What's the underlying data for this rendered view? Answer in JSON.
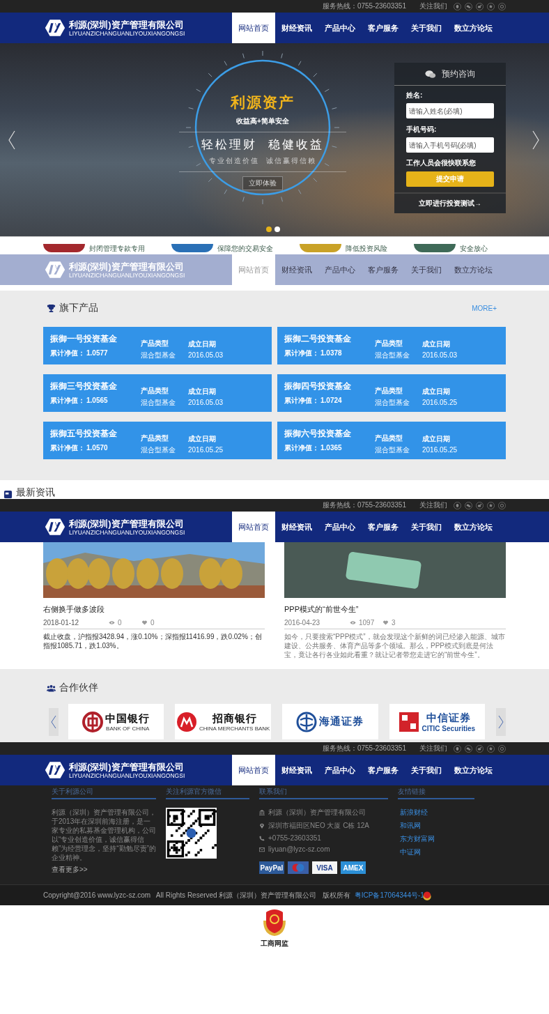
{
  "headers": [
    {
      "faded": false,
      "top_bar": {
        "hotline": "服务热线：0755-23603351",
        "follow": "关注我们"
      },
      "logo": {
        "name": "利源(深圳)资产管理有限公司",
        "pinyin": "LIYUANZICHANGUANLIYOUXIANGONGSI"
      },
      "nav": [
        {
          "label": "网站首页",
          "selected": true
        },
        {
          "label": "财经资讯",
          "selected": false
        },
        {
          "label": "产品中心",
          "selected": false
        },
        {
          "label": "客户服务",
          "selected": false
        },
        {
          "label": "关于我们",
          "selected": false
        },
        {
          "label": "数立方论坛",
          "selected": false
        }
      ]
    },
    {
      "faded": true,
      "logo": {
        "name": "利源(深圳)资产管理有限公司",
        "pinyin": "LIYUANZICHANGUANLIYOUXIANGONGSI"
      },
      "nav": [
        {
          "label": "网站首页",
          "selected": true
        },
        {
          "label": "财经资讯",
          "selected": false
        },
        {
          "label": "产品中心",
          "selected": false
        },
        {
          "label": "客户服务",
          "selected": false
        },
        {
          "label": "关于我们",
          "selected": false
        },
        {
          "label": "数立方论坛",
          "selected": false
        }
      ]
    },
    {
      "faded": false,
      "top_bar": {
        "hotline": "服务热线：0755-23603351",
        "follow": "关注我们"
      },
      "logo": {
        "name": "利源(深圳)资产管理有限公司",
        "pinyin": "LIYUANZICHANGUANLIYOUXIANGONGSI"
      },
      "nav": [
        {
          "label": "网站首页",
          "selected": true
        },
        {
          "label": "财经资讯",
          "selected": false
        },
        {
          "label": "产品中心",
          "selected": false
        },
        {
          "label": "客户服务",
          "selected": false
        },
        {
          "label": "关于我们",
          "selected": false
        },
        {
          "label": "数立方论坛",
          "selected": false
        }
      ]
    },
    {
      "faded": false,
      "top_bar": {
        "hotline": "服务热线：0755-23603351",
        "follow": "关注我们"
      },
      "logo": {
        "name": "利源(深圳)资产管理有限公司",
        "pinyin": "LIYUANZICHANGUANLIYOUXIANGONGSI"
      },
      "nav": [
        {
          "label": "网站首页",
          "selected": true
        },
        {
          "label": "财经资讯",
          "selected": false
        },
        {
          "label": "产品中心",
          "selected": false
        },
        {
          "label": "客户服务",
          "selected": false
        },
        {
          "label": "关于我们",
          "selected": false
        },
        {
          "label": "数立方论坛",
          "selected": false
        }
      ]
    }
  ],
  "hero": {
    "title": "利源资产",
    "subtitle": "收益高+简单安全",
    "slogan": "轻松理财  稳健收益",
    "tagline": "专业创造价值  诚信赢得信赖",
    "button": "立即体验",
    "dots": [
      {
        "selected": true
      },
      {
        "selected": false
      }
    ],
    "consult": {
      "title": "预约咨询",
      "fields": [
        {
          "label": "姓名:",
          "placeholder": "请输入姓名(必填)"
        },
        {
          "label": "手机号码:",
          "placeholder": "请输入手机号码(必填)"
        }
      ],
      "note": "工作人员会很快联系您",
      "submit": "提交申请",
      "link": "立即进行投资测试→"
    }
  },
  "features": [
    {
      "text": "封闭管理专款专用",
      "color": "#a3282d"
    },
    {
      "text": "保障您的交易安全",
      "color": "#2a70b6"
    },
    {
      "text": "降低投资风险",
      "color": "#c9a227"
    },
    {
      "text": "安全放心",
      "color": "#3f6a58"
    }
  ],
  "products": {
    "title": "旗下产品",
    "more": "MORE+",
    "items": [
      {
        "name": "振御一号投资基金",
        "nav_label": "累计净值：",
        "nav": "1.0577",
        "type_label": "产品类型",
        "type": "混合型基金",
        "date_label": "成立日期",
        "date": "2016.05.03"
      },
      {
        "name": "振御二号投资基金",
        "nav_label": "累计净值：",
        "nav": "1.0378",
        "type_label": "产品类型",
        "type": "混合型基金",
        "date_label": "成立日期",
        "date": "2016.05.03"
      },
      {
        "name": "振御三号投资基金",
        "nav_label": "累计净值：",
        "nav": "1.0565",
        "type_label": "产品类型",
        "type": "混合型基金",
        "date_label": "成立日期",
        "date": "2016.05.03"
      },
      {
        "name": "振御四号投资基金",
        "nav_label": "累计净值：",
        "nav": "1.0724",
        "type_label": "产品类型",
        "type": "混合型基金",
        "date_label": "成立日期",
        "date": "2016.05.25"
      },
      {
        "name": "振御五号投资基金",
        "nav_label": "累计净值：",
        "nav": "1.0570",
        "type_label": "产品类型",
        "type": "混合型基金",
        "date_label": "成立日期",
        "date": "2016.05.25"
      },
      {
        "name": "振御六号投资基金",
        "nav_label": "累计净值：",
        "nav": "1.0365",
        "type_label": "产品类型",
        "type": "混合型基金",
        "date_label": "成立日期",
        "date": "2016.05.25"
      }
    ]
  },
  "news": {
    "title": "最新资讯",
    "items": [
      {
        "kind": "landscape",
        "title": "右侧换手做多波段",
        "date": "2018-01-12",
        "views": "0",
        "likes": "0",
        "summary": "截止收盘，沪指报3428.94，涨0.10%；深指报11416.99，跌0.02%；创指报1085.71，跌1.03%。"
      },
      {
        "kind": "closeup",
        "title": "PPP模式的“前世今生”",
        "date": "2016-04-23",
        "views": "1097",
        "likes": "3",
        "summary": "如今，只要搜索“PPP模式”，就会发现这个新鲜的词已经渗入能源、城市建设、公共服务、体育产品等多个领域。那么，PPP模式到底是何法宝，竟让各行各业如此看重？就让记者带您走进它的“前世今生”。"
      }
    ]
  },
  "partners": {
    "title": "合作伙伴",
    "items": [
      {
        "kind": "boc",
        "name": "中国银行",
        "english": "BANK OF CHINA"
      },
      {
        "kind": "cmb",
        "name": "招商银行",
        "english": "CHINA MERCHANTS BANK"
      },
      {
        "kind": "haitong",
        "name": "海通证券"
      },
      {
        "kind": "citic",
        "name": "中信证券",
        "english": "CITIC Securities"
      }
    ]
  },
  "footer": {
    "columns": [
      "关于利源公司",
      "关注利源官方微信",
      "联系我们",
      "友情链接"
    ],
    "about": "利源（深圳）资产管理有限公司，于2013年在深圳前海注册，是一家专业的私募基金管理机构，公司以“专业创造价值，诚信赢得信赖”为经营理念，坚持“勤勉尽责”的企业精神。",
    "about_more": "查看更多>>",
    "contacts": [
      {
        "kind": "company",
        "text": "利源（深圳）资产管理有限公司"
      },
      {
        "kind": "address",
        "text": "深圳市福田区NEO 大厦 C栋 12A"
      },
      {
        "kind": "phone",
        "text": "+0755-23603351"
      },
      {
        "kind": "email",
        "text": "liyuan@lyzc-sz.com"
      }
    ],
    "payments": [
      {
        "kind": "paypal",
        "label": "PayPal"
      },
      {
        "kind": "maestro"
      },
      {
        "kind": "visa",
        "label": "VISA"
      },
      {
        "kind": "amex",
        "label": "AMEX"
      }
    ],
    "links": [
      "新浪财经",
      "和讯网",
      "东方财富网",
      "中证网"
    ],
    "copyright": "Copyright@2016 www.lyzc-sz.com   All Rights Reserved 利源（深圳）资产管理有限公司   版权所有",
    "icp": "粤ICP备17064344号-1",
    "badge_label": "工商网监"
  }
}
